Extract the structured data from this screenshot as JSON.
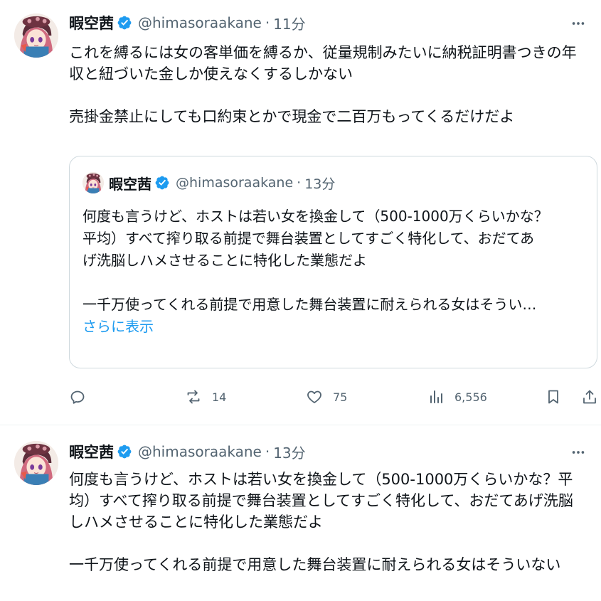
{
  "tweets": [
    {
      "author": {
        "display_name": "暇空茜",
        "handle": "@himasoraakane",
        "verified": true
      },
      "separator": "·",
      "time": "11分",
      "text_lines": [
        "これを縛るには女の客単価を縛るか、従量規制みたいに納税証明書つきの年",
        "収と紐づいた金しか使えなくするしかない",
        "",
        "売掛金禁止にしても口約束とかで現金で二百万もってくるだけだよ"
      ],
      "quoted": {
        "author": {
          "display_name": "暇空茜",
          "handle": "@himasoraakane",
          "verified": true
        },
        "separator": "·",
        "time": "13分",
        "text_lines": [
          "何度も言うけど、ホストは若い女を換金して（500-1000万くらいかな？",
          "平均）すべて搾り取る前提で舞台装置としてすごく特化して、おだてあ",
          "げ洗脳しハメさせることに特化した業態だよ",
          "",
          "一千万使ってくれる前提で用意した舞台装置に耐えられる女はそうい…"
        ],
        "show_more": "さらに表示"
      },
      "actions": {
        "reply": {
          "icon": "reply-icon",
          "count": ""
        },
        "retweet": {
          "icon": "retweet-icon",
          "count": "14"
        },
        "like": {
          "icon": "like-icon",
          "count": "75"
        },
        "views": {
          "icon": "views-icon",
          "count": "6,556"
        },
        "bookmark": {
          "icon": "bookmark-icon"
        },
        "share": {
          "icon": "share-icon"
        }
      }
    },
    {
      "author": {
        "display_name": "暇空茜",
        "handle": "@himasoraakane",
        "verified": true
      },
      "separator": "·",
      "time": "13分",
      "text_lines": [
        "何度も言うけど、ホストは若い女を換金して（500-1000万くらいかな？平",
        "均）すべて搾り取る前提で舞台装置としてすごく特化して、おだてあげ洗脳",
        "しハメさせることに特化した業態だよ",
        "",
        "一千万使ってくれる前提で用意した舞台装置に耐えられる女はそういない"
      ]
    }
  ],
  "colors": {
    "text": "#0f1419",
    "secondary": "#536471",
    "link": "#1d9bf0",
    "verified": "#1d9bf0",
    "border": "#cfd9de"
  }
}
